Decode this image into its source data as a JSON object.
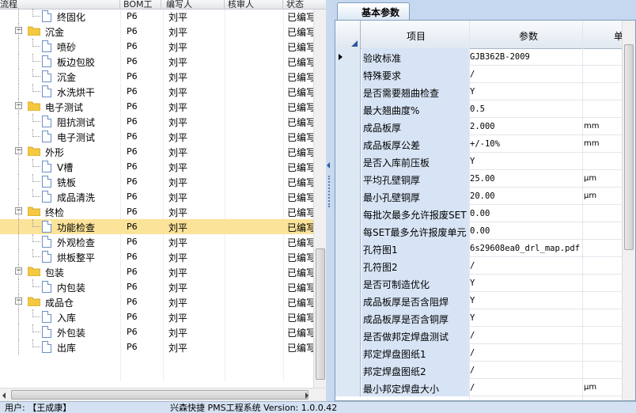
{
  "left_panel": {
    "columns": [
      "流程",
      "BOM工厂",
      "编写人",
      "核审人",
      "状态"
    ],
    "rows": [
      {
        "name": "终固化",
        "type": "doc",
        "level": 2,
        "bom": "P6",
        "editor": "刘平",
        "reviewer": "",
        "status": "已编写"
      },
      {
        "name": "沉金",
        "type": "folder",
        "level": 1,
        "bom": "P6",
        "editor": "刘平",
        "reviewer": "",
        "status": "已编写"
      },
      {
        "name": "喷砂",
        "type": "doc",
        "level": 2,
        "bom": "P6",
        "editor": "刘平",
        "reviewer": "",
        "status": "已编写"
      },
      {
        "name": "板边包胶",
        "type": "doc",
        "level": 2,
        "bom": "P6",
        "editor": "刘平",
        "reviewer": "",
        "status": "已编写"
      },
      {
        "name": "沉金",
        "type": "doc",
        "level": 2,
        "bom": "P6",
        "editor": "刘平",
        "reviewer": "",
        "status": "已编写"
      },
      {
        "name": "水洗烘干",
        "type": "doc",
        "level": 2,
        "bom": "P6",
        "editor": "刘平",
        "reviewer": "",
        "status": "已编写"
      },
      {
        "name": "电子测试",
        "type": "folder",
        "level": 1,
        "bom": "P6",
        "editor": "刘平",
        "reviewer": "",
        "status": "已编写"
      },
      {
        "name": "阻抗测试",
        "type": "doc",
        "level": 2,
        "bom": "P6",
        "editor": "刘平",
        "reviewer": "",
        "status": "已编写"
      },
      {
        "name": "电子测试",
        "type": "doc",
        "level": 2,
        "bom": "P6",
        "editor": "刘平",
        "reviewer": "",
        "status": "已编写"
      },
      {
        "name": "外形",
        "type": "folder",
        "level": 1,
        "bom": "P6",
        "editor": "刘平",
        "reviewer": "",
        "status": "已编写"
      },
      {
        "name": "V槽",
        "type": "doc",
        "level": 2,
        "bom": "P6",
        "editor": "刘平",
        "reviewer": "",
        "status": "已编写"
      },
      {
        "name": "铣板",
        "type": "doc",
        "level": 2,
        "bom": "P6",
        "editor": "刘平",
        "reviewer": "",
        "status": "已编写"
      },
      {
        "name": "成品清洗",
        "type": "doc",
        "level": 2,
        "bom": "P6",
        "editor": "刘平",
        "reviewer": "",
        "status": "已编写"
      },
      {
        "name": "终检",
        "type": "folder",
        "level": 1,
        "bom": "P6",
        "editor": "刘平",
        "reviewer": "",
        "status": "已编写"
      },
      {
        "name": "功能检查",
        "type": "doc",
        "level": 2,
        "bom": "P6",
        "editor": "刘平",
        "reviewer": "",
        "status": "已编写",
        "selected": true
      },
      {
        "name": "外观检查",
        "type": "doc",
        "level": 2,
        "bom": "P6",
        "editor": "刘平",
        "reviewer": "",
        "status": "已编写"
      },
      {
        "name": "烘板整平",
        "type": "doc",
        "level": 2,
        "bom": "P6",
        "editor": "刘平",
        "reviewer": "",
        "status": "已编写"
      },
      {
        "name": "包装",
        "type": "folder",
        "level": 1,
        "bom": "P6",
        "editor": "刘平",
        "reviewer": "",
        "status": "已编写"
      },
      {
        "name": "内包装",
        "type": "doc",
        "level": 2,
        "bom": "P6",
        "editor": "刘平",
        "reviewer": "",
        "status": "已编写"
      },
      {
        "name": "成品仓",
        "type": "folder",
        "level": 1,
        "bom": "P6",
        "editor": "刘平",
        "reviewer": "",
        "status": "已编写"
      },
      {
        "name": "入库",
        "type": "doc",
        "level": 2,
        "bom": "P6",
        "editor": "刘平",
        "reviewer": "",
        "status": "已编写"
      },
      {
        "name": "外包装",
        "type": "doc",
        "level": 2,
        "bom": "P6",
        "editor": "刘平",
        "reviewer": "",
        "status": "已编写"
      },
      {
        "name": "出库",
        "type": "doc",
        "level": 2,
        "bom": "P6",
        "editor": "刘平",
        "reviewer": "",
        "status": "已编写"
      }
    ]
  },
  "right_panel": {
    "tab_label": "基本参数",
    "columns": {
      "item": "项目",
      "param": "参数",
      "unit": "单"
    },
    "rows": [
      {
        "item": "验收标准",
        "value": "GJB362B-2009",
        "unit": "",
        "current": true
      },
      {
        "item": "特殊要求",
        "value": "/",
        "unit": ""
      },
      {
        "item": "是否需要翘曲检查",
        "value": "Y",
        "unit": ""
      },
      {
        "item": "最大翘曲度%",
        "value": "0.5",
        "unit": ""
      },
      {
        "item": "成品板厚",
        "value": "2.000",
        "unit": "mm"
      },
      {
        "item": "成品板厚公差",
        "value": "+/-10%",
        "unit": "mm"
      },
      {
        "item": "是否入库前压板",
        "value": "Y",
        "unit": ""
      },
      {
        "item": "平均孔壁铜厚",
        "value": "25.00",
        "unit": "μm"
      },
      {
        "item": "最小孔壁铜厚",
        "value": "20.00",
        "unit": "μm"
      },
      {
        "item": "每批次最多允许报废SET",
        "value": "0.00",
        "unit": ""
      },
      {
        "item": "每SET最多允许报废单元",
        "value": "0.00",
        "unit": ""
      },
      {
        "item": "孔符图1",
        "value": "6s29608ea0_drl_map.pdf",
        "unit": ""
      },
      {
        "item": "孔符图2",
        "value": "/",
        "unit": ""
      },
      {
        "item": "是否可制造优化",
        "value": "Y",
        "unit": ""
      },
      {
        "item": "成品板厚是否含阻焊",
        "value": "Y",
        "unit": ""
      },
      {
        "item": "成品板厚是否含铜厚",
        "value": "Y",
        "unit": ""
      },
      {
        "item": "是否做邦定焊盘测试",
        "value": "/",
        "unit": ""
      },
      {
        "item": "邦定焊盘图纸1",
        "value": "/",
        "unit": ""
      },
      {
        "item": "邦定焊盘图纸2",
        "value": "/",
        "unit": ""
      },
      {
        "item": "最小邦定焊盘大小",
        "value": "/",
        "unit": "μm"
      }
    ]
  },
  "status_bar": {
    "left": "用户: 【王成康】",
    "right": "兴森快捷 PMS工程系统 Version: 1.0.0.42"
  }
}
